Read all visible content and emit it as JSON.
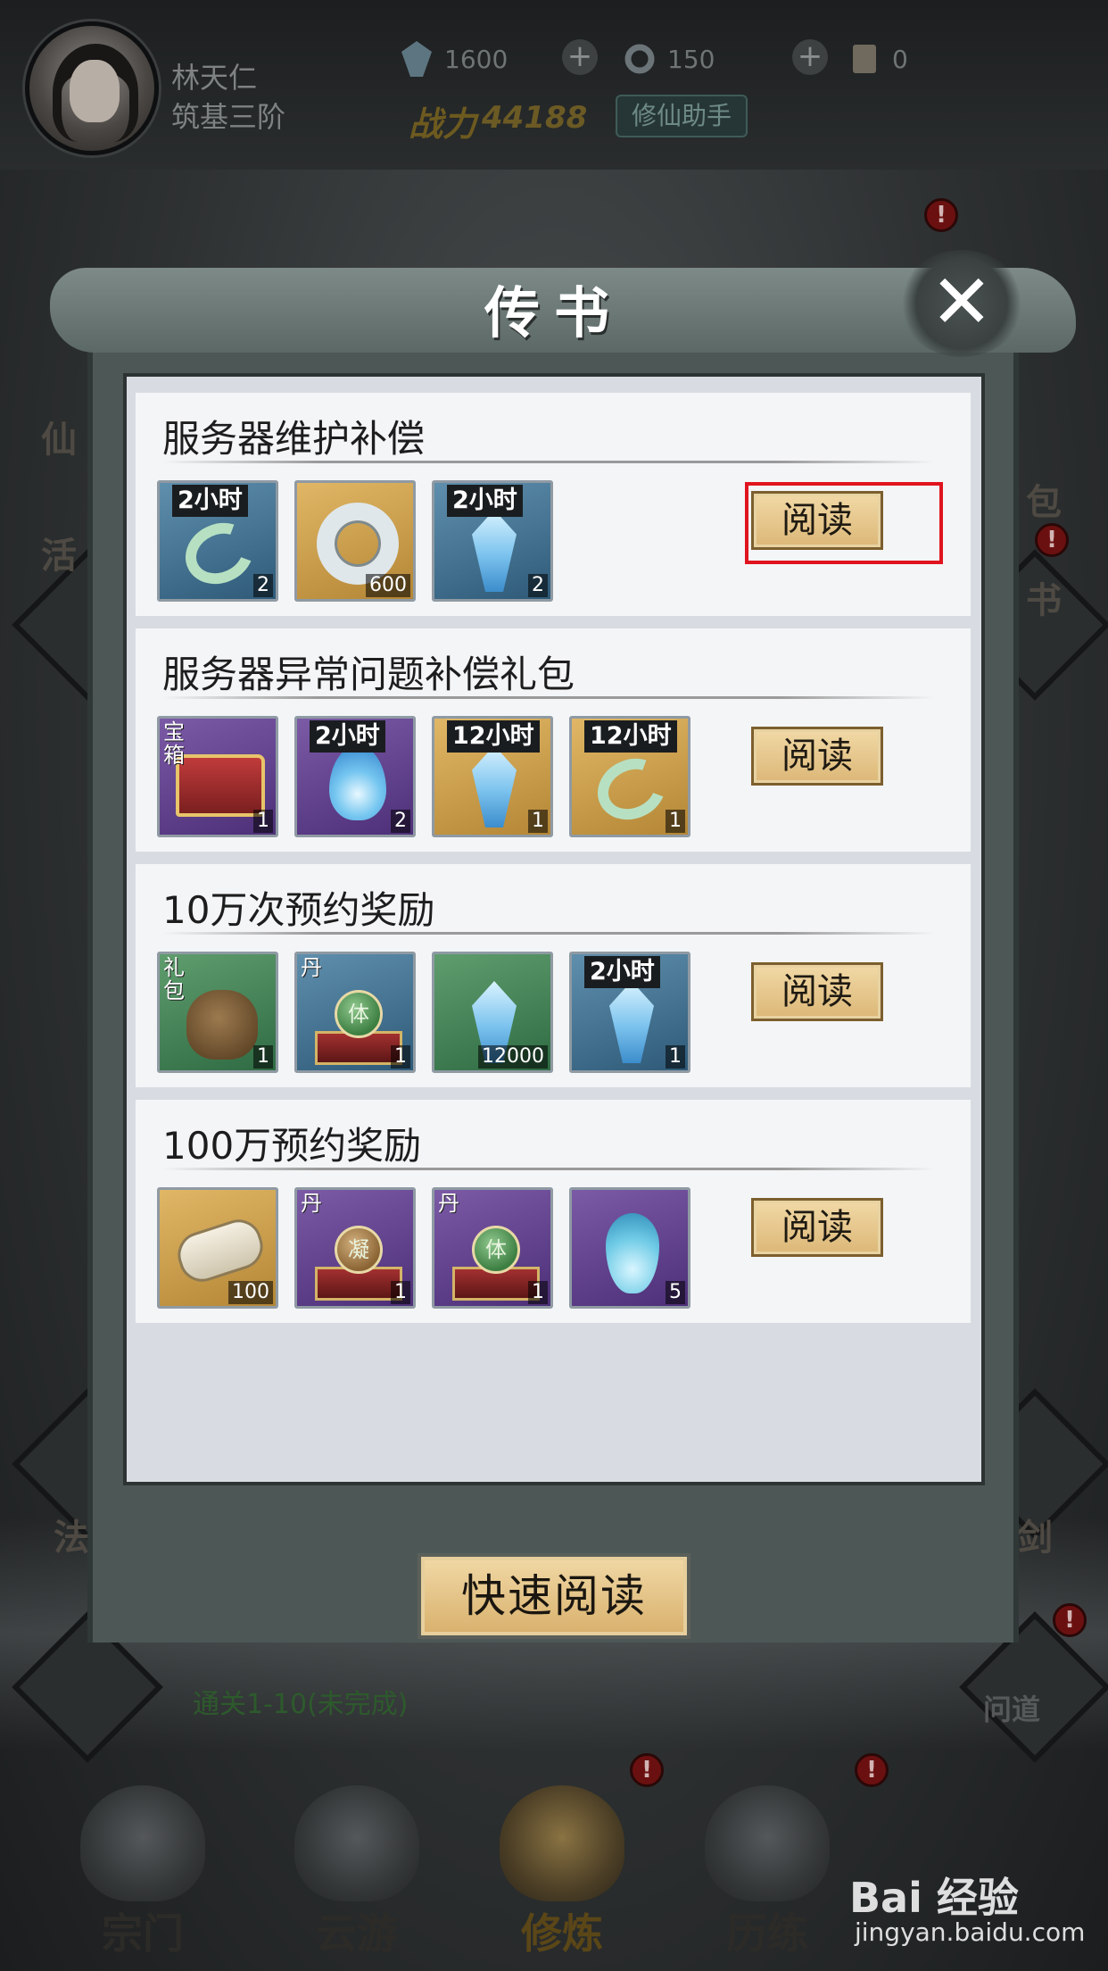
{
  "player": {
    "name": "林天仁",
    "rank": "筑基三阶",
    "power_label": "战力",
    "power_value": "44188",
    "assistant_button": "修仙助手"
  },
  "resources": [
    {
      "icon": "crystal-icon",
      "value": "1600"
    },
    {
      "icon": "jade-ring-icon",
      "value": "150"
    },
    {
      "icon": "scroll-icon",
      "value": "0"
    }
  ],
  "background": {
    "side_labels": [
      "仙",
      "活",
      "包",
      "书",
      "法",
      "剑"
    ],
    "quest_text": "通关1-10(未完成)",
    "wendao_label": "问道",
    "alert_mark": "!"
  },
  "nav": [
    {
      "label": "宗门",
      "active": false
    },
    {
      "label": "云游",
      "active": false
    },
    {
      "label": "修炼",
      "active": true
    },
    {
      "label": "历练",
      "active": false
    }
  ],
  "dialog": {
    "title": "传书",
    "close_label": "✕",
    "quick_read_label": "快速阅读",
    "read_label": "阅读",
    "mails": [
      {
        "title": "服务器维护补偿",
        "rewards": [
          {
            "art": "swirl",
            "bg": "blue",
            "tag": "2小时",
            "count": "2"
          },
          {
            "art": "ring",
            "bg": "gold",
            "count": "600"
          },
          {
            "art": "crystal",
            "bg": "blue",
            "tag": "2小时",
            "count": "2"
          }
        ]
      },
      {
        "title": "服务器异常问题补偿礼包",
        "rewards": [
          {
            "art": "chest-scroll",
            "bg": "purple",
            "corner": "宝箱",
            "count": "1"
          },
          {
            "art": "flame",
            "bg": "purple",
            "tag": "2小时",
            "count": "2"
          },
          {
            "art": "crystal",
            "bg": "gold",
            "tag": "12小时",
            "count": "1"
          },
          {
            "art": "swirl",
            "bg": "gold",
            "tag": "12小时",
            "count": "1"
          }
        ]
      },
      {
        "title": "10万次预约奖励",
        "rewards": [
          {
            "art": "bag",
            "bg": "green",
            "corner": "礼包",
            "count": "1"
          },
          {
            "art": "pill-chest",
            "bg": "blue",
            "corner": "丹",
            "pill": "体",
            "count": "1"
          },
          {
            "art": "crystal",
            "bg": "green",
            "count": "12000"
          },
          {
            "art": "crystal",
            "bg": "blue",
            "tag": "2小时",
            "count": "1"
          }
        ]
      },
      {
        "title": "100万预约奖励",
        "rewards": [
          {
            "art": "scroll",
            "bg": "gold",
            "count": "100"
          },
          {
            "art": "pill-chest",
            "bg": "purple",
            "corner": "丹",
            "pill": "凝",
            "count": "1"
          },
          {
            "art": "pill-chest",
            "bg": "purple",
            "corner": "丹",
            "pill": "体",
            "count": "1"
          },
          {
            "art": "drop",
            "bg": "purple",
            "count": "5"
          }
        ]
      }
    ]
  },
  "watermark": {
    "logo": "Bai 经验",
    "url": "jingyan.baidu.com"
  }
}
